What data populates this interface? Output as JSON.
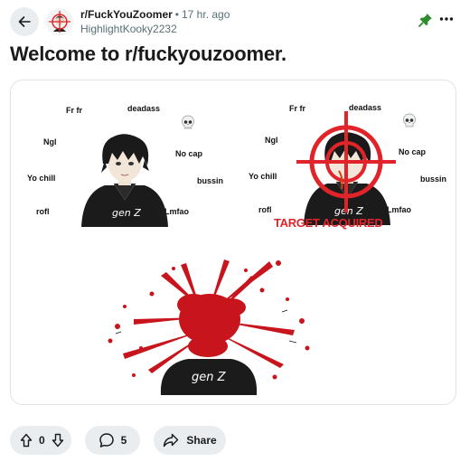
{
  "post": {
    "subreddit": "r/FuckYouZoomer",
    "separator": "•",
    "time_ago": "17 hr. ago",
    "author": "HighlightKooky2232",
    "title": "Welcome to r/fuckyouzoomer."
  },
  "media": {
    "left_panel_words": [
      "Fr fr",
      "deadass",
      "Ngl",
      "No cap",
      "Yo chill",
      "bussin",
      "rofl",
      "Lmfao"
    ],
    "right_panel_words": [
      "Fr fr",
      "deadass",
      "Ngl",
      "No cap",
      "Yo chill",
      "bussin",
      "rofl",
      "Lmfao"
    ],
    "overlay_text": "TARGET ACQUIRED",
    "shirt_text": "gen Z",
    "accent_red": "#e0242a"
  },
  "actions": {
    "vote_count": "0",
    "comment_count": "5",
    "share_label": "Share"
  },
  "colors": {
    "pill_bg": "#eaedef",
    "pin_green": "#2e8b2e",
    "text_muted": "#576f76"
  }
}
